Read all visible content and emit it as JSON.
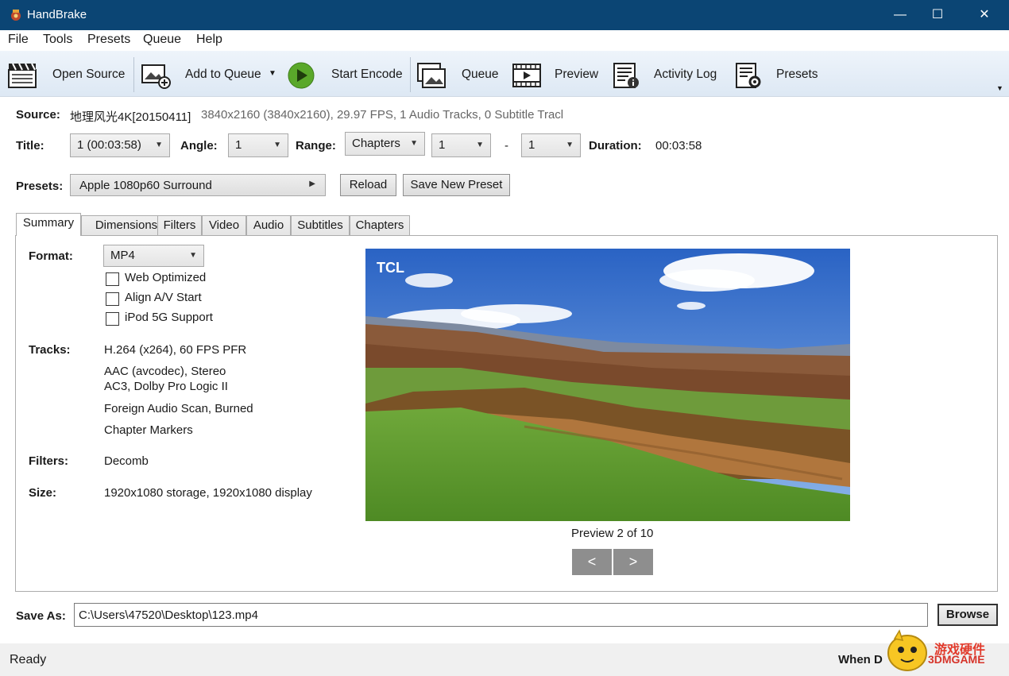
{
  "window": {
    "title": "HandBrake",
    "controls": {
      "minimize": "—",
      "maximize": "☐",
      "close": "✕"
    }
  },
  "menu": [
    "File",
    "Tools",
    "Presets",
    "Queue",
    "Help"
  ],
  "toolbar": {
    "open_source": "Open Source",
    "add_to_queue": "Add to Queue",
    "start_encode": "Start Encode",
    "queue": "Queue",
    "preview": "Preview",
    "activity_log": "Activity Log",
    "presets": "Presets"
  },
  "source": {
    "label": "Source:",
    "name": "地理风光4K[20150411]",
    "info": "3840x2160 (3840x2160), 29.97 FPS, 1 Audio Tracks, 0 Subtitle Tracl"
  },
  "title_row": {
    "title_label": "Title:",
    "title_value": "1 (00:03:58)",
    "angle_label": "Angle:",
    "angle_value": "1",
    "range_label": "Range:",
    "range_value": "Chapters",
    "range_start": "1",
    "range_sep": "-",
    "range_end": "1",
    "duration_label": "Duration:",
    "duration_value": "00:03:58"
  },
  "presets_row": {
    "label": "Presets:",
    "value": "Apple 1080p60 Surround",
    "reload": "Reload",
    "save_new": "Save New Preset"
  },
  "tabs": [
    "Summary",
    "Dimensions",
    "Filters",
    "Video",
    "Audio",
    "Subtitles",
    "Chapters"
  ],
  "summary": {
    "format_label": "Format:",
    "format_value": "MP4",
    "web_optimized": "Web Optimized",
    "align_av": "Align A/V Start",
    "ipod": "iPod 5G Support",
    "tracks_label": "Tracks:",
    "track_video": "H.264 (x264), 60 FPS PFR",
    "track_audio1": "AAC (avcodec), Stereo",
    "track_audio2": "AC3, Dolby Pro Logic II",
    "track_subs": "Foreign Audio Scan, Burned",
    "track_chapters": "Chapter Markers",
    "filters_label": "Filters:",
    "filters_value": "Decomb",
    "size_label": "Size:",
    "size_value": "1920x1080 storage, 1920x1080 display",
    "preview_logo": "TCL",
    "preview_caption": "Preview 2 of 10",
    "prev": "<",
    "next": ">"
  },
  "save_as": {
    "label": "Save As:",
    "value": "C:\\Users\\47520\\Desktop\\123.mp4",
    "browse": "Browse"
  },
  "status": {
    "text": "Ready",
    "when_done": "When D"
  },
  "watermark": {
    "text": "游戏硬件",
    "subtext": "3DMGAME"
  }
}
